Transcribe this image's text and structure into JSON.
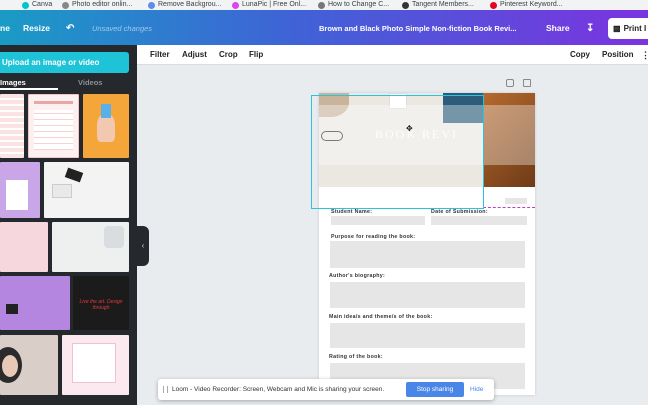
{
  "bookmarks": [
    "Canva",
    "Photo editor onlin...",
    "Remove Backgrou...",
    "LunaPic | Free Onl...",
    "How to Change C...",
    "Tangent Members...",
    "Pinterest Keyword..."
  ],
  "topbar": {
    "home": "ne",
    "resize": "Resize",
    "unsaved": "Unsaved changes",
    "design_title": "Brown and Black Photo Simple Non-fiction Book Revi...",
    "share": "Share",
    "print": "Print I"
  },
  "sidebar": {
    "upload_label": "Upload an image or video",
    "tab_images": "Images",
    "tab_videos": "Videos",
    "red_thumb_text": "Live the art. Design through"
  },
  "toolbar": {
    "filter": "Filter",
    "adjust": "Adjust",
    "crop": "Crop",
    "flip": "Flip",
    "copy": "Copy",
    "position": "Position"
  },
  "page": {
    "header_text": "BOOK REVI",
    "fields": {
      "student_name": "Student Name:",
      "date": "Date of Submission:",
      "purpose": "Purpose for reading the book:",
      "bio": "Author's biography:",
      "ideas": "Main idea/s and theme/s of the book:",
      "rating": "Rating of the book:"
    }
  },
  "notification": {
    "text": "Loom - Video Recorder: Screen, Webcam and Mic is sharing your screen.",
    "stop": "Stop sharing",
    "hide": "Hide"
  }
}
